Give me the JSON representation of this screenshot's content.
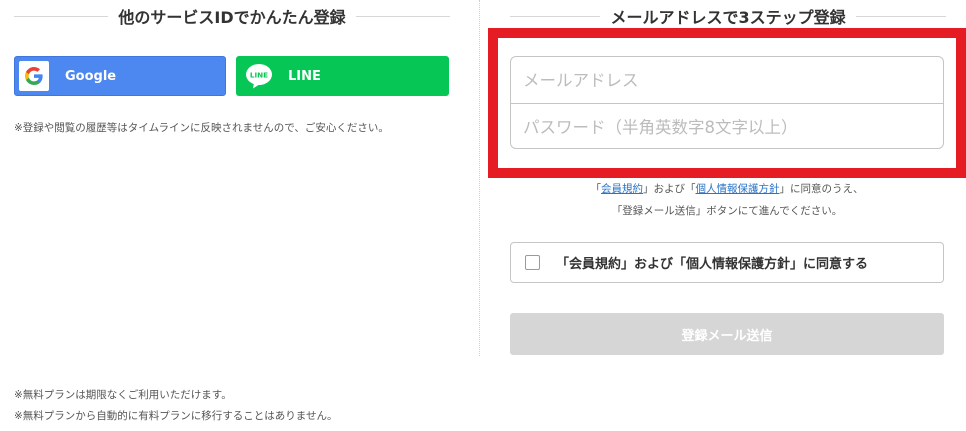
{
  "left": {
    "heading": "他のサービスIDでかんたん登録",
    "google_label": "Google",
    "line_label": "LINE",
    "line_icon_text": "LINE",
    "note": "※登録や閲覧の履歴等はタイムラインに反映されませんので、ご安心ください。"
  },
  "right": {
    "heading": "メールアドレスで3ステップ登録",
    "email_placeholder": "メールアドレス",
    "password_placeholder": "パスワード（半角英数字8文字以上）",
    "agree_text": {
      "open1": "「",
      "terms_link": "会員規約",
      "mid1": "」および「",
      "privacy_link": "個人情報保護方針",
      "tail1": "」に同意のうえ、",
      "line2": "「登録メール送信」ボタンにて進んでください。"
    },
    "checkbox_label": "「会員規約」および「個人情報保護方針」に同意する",
    "submit_label": "登録メール送信"
  },
  "footer": {
    "note1": "※無料プランは期限なくご利用いただけます。",
    "note2": "※無料プランから自動的に有料プランに移行することはありません。"
  },
  "colors": {
    "google_blue": "#4d87f0",
    "line_green": "#06c755",
    "highlight_red": "#e51c23",
    "link_blue": "#2a74c7",
    "disabled_gray": "#d6d6d6"
  },
  "icons": [
    "google-icon",
    "line-icon"
  ]
}
